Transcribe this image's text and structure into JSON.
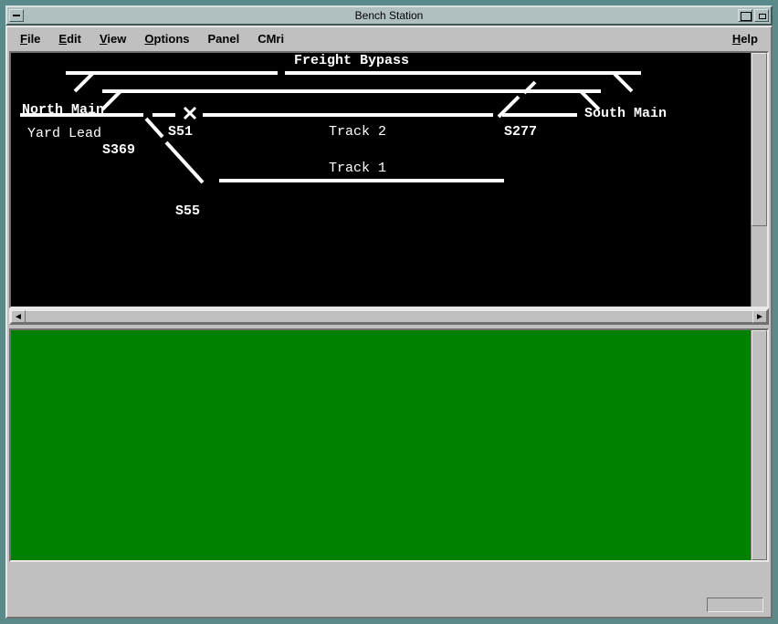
{
  "window": {
    "title": "Bench Station"
  },
  "menu": {
    "file": "File",
    "edit": "Edit",
    "view": "View",
    "options": "Options",
    "panel": "Panel",
    "cmri": "CMri",
    "help": "Help"
  },
  "diagram": {
    "labels": {
      "freight_bypass": "Freight Bypass",
      "north_main": "North Main",
      "south_main": "South Main",
      "yard_lead": "Yard Lead",
      "track1": "Track 1",
      "track2": "Track 2",
      "s51": "S51",
      "s55": "S55",
      "s277": "S277",
      "s369": "S369"
    }
  }
}
